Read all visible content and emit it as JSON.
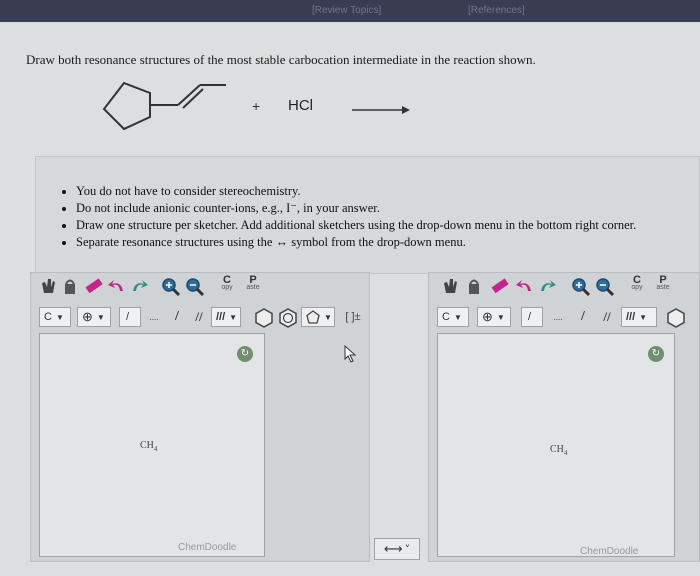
{
  "header": {
    "link_left": "[Review Topics]",
    "link_right": "[References]"
  },
  "question": {
    "text": "Draw both resonance structures of the most stable carbocation intermediate in the reaction shown."
  },
  "reaction": {
    "plus": "+",
    "reagent": "HCl"
  },
  "hints": [
    "You do not have to consider stereochemistry.",
    "Do not include anionic counter-ions, e.g., I⁻, in your answer.",
    "Draw one structure per sketcher. Add additional sketchers using the drop-down menu in the bottom right corner.",
    "Separate resonance structures using the ↔ symbol from the drop-down menu."
  ],
  "sketchers": [
    {
      "copy_big": "C",
      "copy_small": "opy",
      "paste_big": "P",
      "paste_small": "aste",
      "element_select": "C",
      "ch4_main": "CH",
      "ch4_sub": "4",
      "watermark": "ChemDoodle",
      "bond_tools": [
        "/",
        "....",
        "/",
        "//",
        "///"
      ],
      "brackets": "[ ]±"
    },
    {
      "copy_big": "C",
      "copy_small": "opy",
      "paste_big": "P",
      "paste_small": "aste",
      "element_select": "C",
      "ch4_main": "CH",
      "ch4_sub": "4",
      "watermark": "ChemDoodle",
      "bond_tools": [
        "/",
        "....",
        "/",
        "//",
        "///"
      ]
    }
  ],
  "resonance_dropdown": {
    "symbol": "⟷",
    "caret": "˅"
  },
  "colors": {
    "topbar": "#3a3d52",
    "page": "#dcdedf",
    "accent_green": "#6f8f6f",
    "magenta": "#c3268b",
    "teal": "#2f8d8a"
  }
}
